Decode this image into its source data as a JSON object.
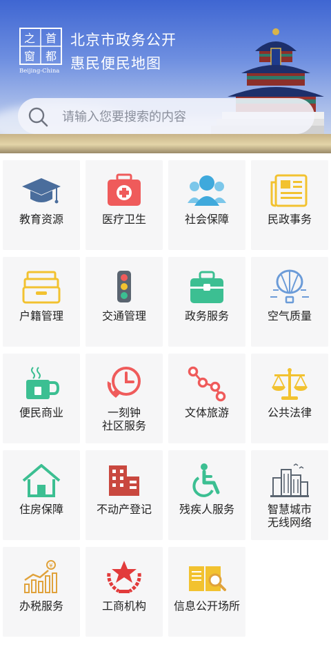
{
  "header": {
    "logo_text": [
      "首",
      "都",
      "之",
      "窗"
    ],
    "logo_caption": "Beijing-China",
    "title_line1": "北京市政务公开",
    "title_line2": "惠民便民地图"
  },
  "search": {
    "placeholder": "请输入您要搜索的内容"
  },
  "categories": [
    {
      "label": "教育资源",
      "icon": "graduation-cap-icon",
      "color": "#4a6d9c"
    },
    {
      "label": "医疗卫生",
      "icon": "medical-kit-icon",
      "color": "#ef5b5b"
    },
    {
      "label": "社会保障",
      "icon": "people-icon",
      "color": "#3fa9dc"
    },
    {
      "label": "民政事务",
      "icon": "newspaper-icon",
      "color": "#f2c230"
    },
    {
      "label": "户籍管理",
      "icon": "file-box-icon",
      "color": "#f2c230"
    },
    {
      "label": "交通管理",
      "icon": "traffic-light-icon",
      "color": "#5a6470"
    },
    {
      "label": "政务服务",
      "icon": "briefcase-icon",
      "color": "#3cbf92"
    },
    {
      "label": "空气质量",
      "icon": "balloon-icon",
      "color": "#6b9bd8"
    },
    {
      "label": "便民商业",
      "icon": "coffee-cup-icon",
      "color": "#3cbf92"
    },
    {
      "label": "一刻钟",
      "label2": "社区服务",
      "icon": "clock-phone-icon",
      "color": "#ef5b5b"
    },
    {
      "label": "文体旅游",
      "icon": "route-icon",
      "color": "#ef5b5b"
    },
    {
      "label": "公共法律",
      "icon": "scales-icon",
      "color": "#f2c230"
    },
    {
      "label": "住房保障",
      "icon": "house-icon",
      "color": "#3cbf92"
    },
    {
      "label": "不动产登记",
      "icon": "building-icon",
      "color": "#c9483f"
    },
    {
      "label": "残疾人服务",
      "icon": "wheelchair-icon",
      "color": "#3cbf92"
    },
    {
      "label": "智慧城市",
      "label2": "无线网络",
      "icon": "smart-city-icon",
      "color": "#5a6470"
    },
    {
      "label": "办税服务",
      "icon": "tax-chart-icon",
      "color": "#e0a23b"
    },
    {
      "label": "工商机构",
      "icon": "star-wreath-icon",
      "color": "#e23b3b"
    },
    {
      "label": "信息公开场所",
      "icon": "book-search-icon",
      "color": "#f2c230"
    }
  ]
}
